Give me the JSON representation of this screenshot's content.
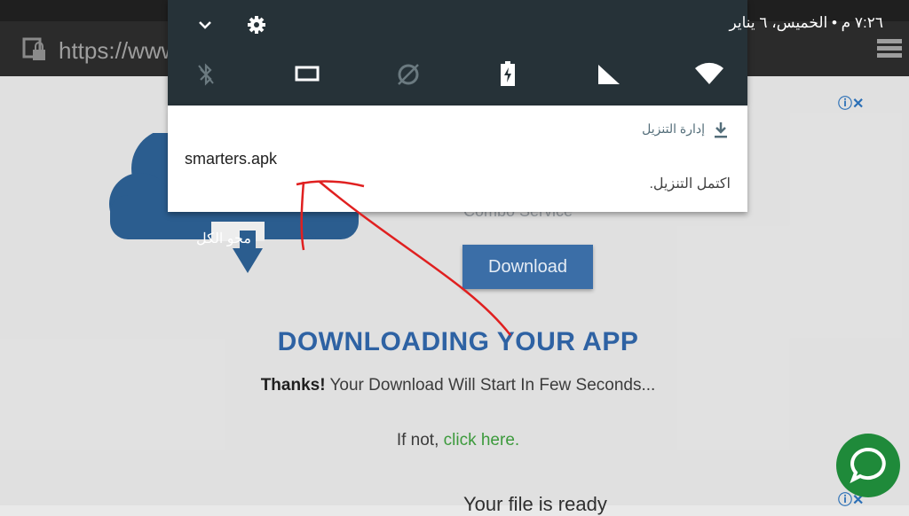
{
  "browser": {
    "url_text": "https://www"
  },
  "page": {
    "cloud_label": "محو الكل",
    "combo_text": "Combo Service",
    "download_button": "Download",
    "heading": "DOWNLOADING YOUR APP",
    "thanks_bold": "Thanks!",
    "thanks_rest": " Your Download Will Start In Few Seconds...",
    "ifnot_prefix": "If not, ",
    "ifnot_link": "click here.",
    "file_ready": "Your file is ready",
    "ad_info": "ⓘ✕"
  },
  "shade": {
    "datetime": "٧:٢٦ م • الخميس، ٦ يناير",
    "quick_settings": [
      "bluetooth-icon",
      "screen-cast-icon",
      "data-saver-icon",
      "battery-saver-icon",
      "signal-icon",
      "wifi-icon"
    ]
  },
  "notification": {
    "app_name": "إدارة التنزيل",
    "title": "smarters.apk",
    "status": "اكتمل التنزيل."
  },
  "colors": {
    "shade_bg": "#263238",
    "brand_blue": "#2e62a3",
    "link_green": "#3c9a3c",
    "annotation_red": "#e02020"
  }
}
